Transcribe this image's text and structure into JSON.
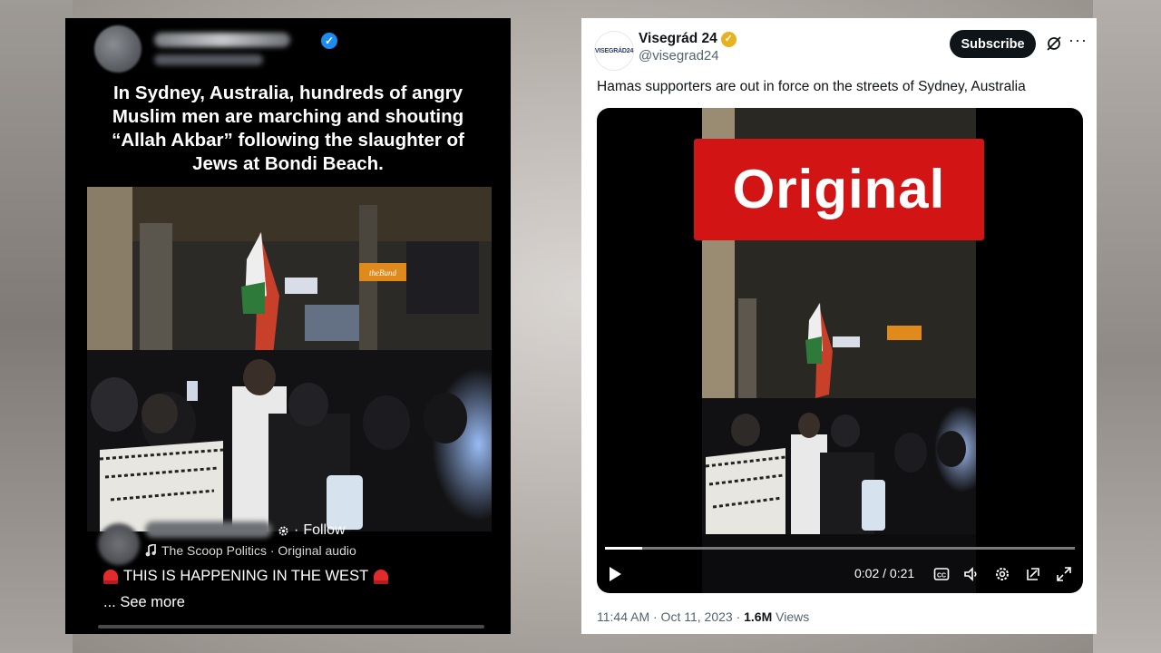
{
  "facebook_post": {
    "caption": "In Sydney, Australia, hundreds of angry Muslim men are marching and shouting “Allah Akbar” following the slaughter of Jews at Bondi Beach.",
    "follow_label": "Follow",
    "audio_label": "The Scoop Politics · Original audio",
    "description": "THIS IS HAPPENING IN THE WEST",
    "see_more_label": "... See more",
    "video_sign_text": "theBund",
    "icons": [
      "verified-badge-icon",
      "gear-icon",
      "music-note-icon",
      "siren-icon"
    ]
  },
  "x_post": {
    "account_name": "Visegrád 24",
    "handle": "@visegrad24",
    "avatar_text": "VISEGRÁD24",
    "subscribe_label": "Subscribe",
    "post_text": "Hamas supporters are out in force on the streets of Sydney, Australia",
    "overlay_label": "Original",
    "video": {
      "time_display": "0:02 / 0:21",
      "progress": 0.08
    },
    "timestamp": "11:44 AM · Oct 11, 2023 · ",
    "views_count": "1.6M",
    "views_label": " Views",
    "icons": [
      "gold-verified-icon",
      "grok-icon",
      "more-icon",
      "play-icon",
      "captions-icon",
      "volume-icon",
      "settings-icon",
      "pip-icon",
      "fullscreen-icon"
    ]
  },
  "colors": {
    "banner_red": "#d21414",
    "fb_background": "#000000",
    "x_text": "#0f1419",
    "x_secondary": "#536471",
    "x_verified_gold": "#e9b120",
    "fb_verified_blue": "#1d8cf0"
  }
}
